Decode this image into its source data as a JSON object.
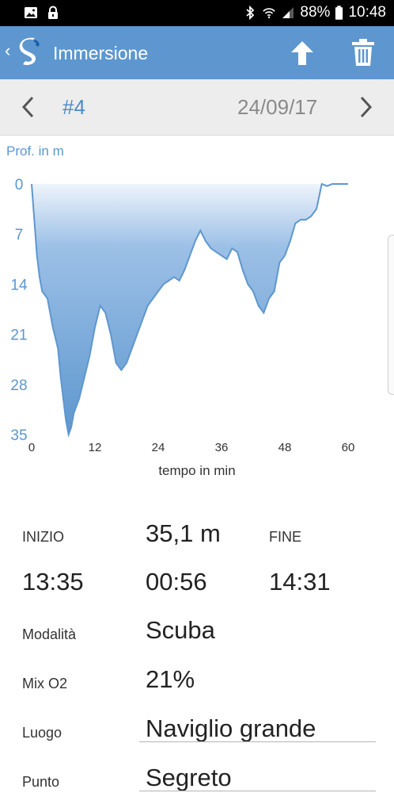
{
  "status_bar": {
    "battery": "88%",
    "time": "10:48",
    "icons": [
      "image-icon",
      "lock-icon",
      "bluetooth-icon",
      "wifi-icon",
      "signal-icon",
      "battery-icon"
    ]
  },
  "app_bar": {
    "title": "Immersione",
    "icons": [
      "back-chevron-icon",
      "scubapro-logo",
      "upload-arrow-icon",
      "trash-icon"
    ],
    "color": "#5e97cf"
  },
  "dive_nav": {
    "number": "#4",
    "date": "24/09/17"
  },
  "chart_data": {
    "type": "area",
    "ylabel": "Prof. in m",
    "xlabel": "tempo in min",
    "y_ticks": [
      "0",
      "7",
      "14",
      "21",
      "28",
      "35"
    ],
    "x_ticks": [
      "0",
      "12",
      "24",
      "36",
      "48",
      "60"
    ],
    "xlim": [
      0,
      60
    ],
    "ylim": [
      0,
      35
    ],
    "y_inverted": true,
    "series": [
      {
        "color": "#5e97cf",
        "x": [
          0,
          0.3,
          1,
          1.5,
          2,
          3,
          4,
          5,
          5.5,
          6,
          6.5,
          7,
          7.5,
          8,
          9,
          10,
          11,
          12,
          13,
          14,
          15,
          16,
          17,
          18,
          19,
          20,
          21,
          22,
          23,
          24,
          25,
          26,
          27,
          28,
          29,
          30,
          31,
          32,
          33,
          34,
          35,
          36,
          37,
          38,
          39,
          40,
          41,
          42,
          43,
          44,
          45,
          46,
          47,
          48,
          49,
          50,
          51,
          52,
          53,
          54,
          55,
          56,
          57,
          58,
          59,
          60
        ],
        "y": [
          0,
          3,
          10,
          13,
          15,
          16,
          20,
          23,
          27,
          30,
          33,
          35,
          34,
          32,
          30,
          27,
          24,
          20,
          17,
          18,
          21,
          25,
          26,
          25,
          23,
          21,
          19,
          17,
          16,
          15,
          14,
          13.5,
          13,
          13.5,
          12,
          10,
          8,
          6.5,
          8,
          9,
          9.5,
          10,
          10.5,
          9,
          9.5,
          12,
          14,
          15,
          17,
          18,
          16,
          15,
          11,
          10,
          8,
          5.5,
          5,
          5,
          4.5,
          3.5,
          0,
          0.3,
          0,
          0,
          0,
          0
        ]
      }
    ]
  },
  "summary": {
    "inizio_label": "INIZIO",
    "max_depth": "35,1 m",
    "fine_label": "FINE",
    "start_time": "13:35",
    "duration": "00:56",
    "end_time": "14:31"
  },
  "details": {
    "modalita_label": "Modalità",
    "modalita_value": "Scuba",
    "mix_label": "Mix O2",
    "mix_value": "21%",
    "luogo_label": "Luogo",
    "luogo_value": "Naviglio grande",
    "punto_label": "Punto",
    "punto_value": "Segreto"
  }
}
